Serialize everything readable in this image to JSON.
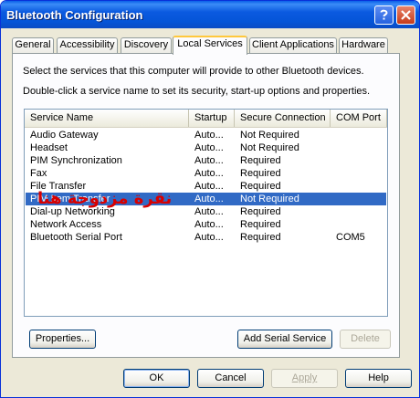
{
  "window": {
    "title": "Bluetooth Configuration"
  },
  "tabs": [
    {
      "label": "General",
      "active": false
    },
    {
      "label": "Accessibility",
      "active": false
    },
    {
      "label": "Discovery",
      "active": false
    },
    {
      "label": "Local Services",
      "active": true
    },
    {
      "label": "Client Applications",
      "active": false
    },
    {
      "label": "Hardware",
      "active": false
    }
  ],
  "description": {
    "line1": "Select the services that this computer will provide to other Bluetooth devices.",
    "line2": "Double-click a service name to set its security, start-up options and properties."
  },
  "list": {
    "columns": [
      "Service Name",
      "Startup",
      "Secure Connection",
      "COM Port"
    ],
    "rows": [
      {
        "name": "Audio Gateway",
        "startup": "Auto...",
        "secure": "Not Required",
        "com": ""
      },
      {
        "name": "Headset",
        "startup": "Auto...",
        "secure": "Not Required",
        "com": ""
      },
      {
        "name": "PIM Synchronization",
        "startup": "Auto...",
        "secure": "Required",
        "com": ""
      },
      {
        "name": "Fax",
        "startup": "Auto...",
        "secure": "Required",
        "com": ""
      },
      {
        "name": "File Transfer",
        "startup": "Auto...",
        "secure": "Required",
        "com": ""
      },
      {
        "name": "PIM Item Transfer",
        "startup": "Auto...",
        "secure": "Not Required",
        "com": "",
        "selected": true
      },
      {
        "name": "Dial-up Networking",
        "startup": "Auto...",
        "secure": "Required",
        "com": ""
      },
      {
        "name": "Network Access",
        "startup": "Auto...",
        "secure": "Required",
        "com": ""
      },
      {
        "name": "Bluetooth Serial Port",
        "startup": "Auto...",
        "secure": "Required",
        "com": "COM5"
      }
    ]
  },
  "overlay_text": "نقرة مزدوجة هنا",
  "panel_buttons": {
    "properties": "Properties...",
    "add_serial": "Add Serial Service",
    "delete": "Delete"
  },
  "dialog_buttons": {
    "ok": "OK",
    "cancel": "Cancel",
    "apply": "Apply",
    "help": "Help"
  },
  "colors": {
    "title_bar": "#0555d8",
    "selection": "#316ac5",
    "close_button": "#c63b1a",
    "overlay_text": "#d80000",
    "active_tab_accent": "#ffc83c"
  }
}
